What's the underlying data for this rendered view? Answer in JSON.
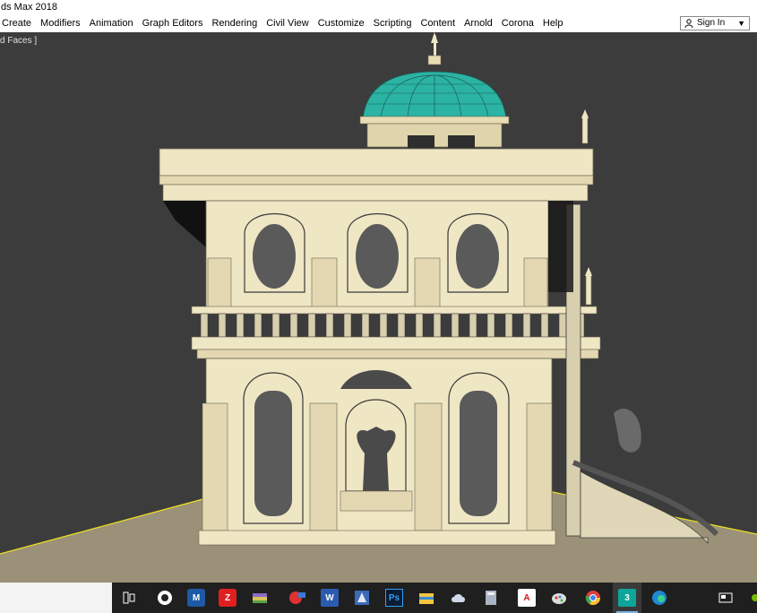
{
  "app": {
    "title": "ds Max 2018"
  },
  "menu": {
    "items": [
      "Create",
      "Modifiers",
      "Animation",
      "Graph Editors",
      "Rendering",
      "Civil View",
      "Customize",
      "Scripting",
      "Content",
      "Arnold",
      "Corona",
      "Help"
    ]
  },
  "account": {
    "sign_in_label": "Sign In"
  },
  "viewport": {
    "label": "d Faces ]"
  },
  "colors": {
    "viewport_bg": "#3c3c3c",
    "ground": "#9b9179",
    "building": "#efe6c4",
    "dome": "#2bb3a3",
    "grid_line": "#f0e020"
  },
  "taskbar": {
    "icons": [
      "task-view-icon",
      "obs-icon",
      "maxon-icon",
      "acrobat-icon",
      "winrar-icon",
      "video-icon",
      "word-icon",
      "reader-icon",
      "photoshop-icon",
      "file-explorer-icon",
      "cloud-icon",
      "calculator-icon",
      "autocad-icon",
      "paint-icon",
      "chrome-icon",
      "3dsmax-icon",
      "edge-icon",
      "news-icon"
    ]
  }
}
